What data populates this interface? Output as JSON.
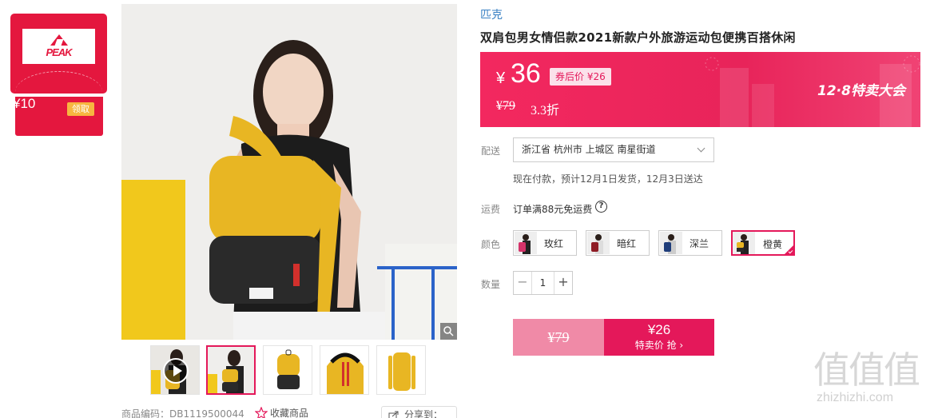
{
  "coupon": {
    "brand_logo": "PEAK",
    "amount": "¥10",
    "claim_label": "领取"
  },
  "product": {
    "brand": "匹克",
    "title": "双肩包男女情侣款2021新款户外旅游运动包便携百搭休闲",
    "sku_code": "商品编码：DB1119500044",
    "favorite_label": "收藏商品",
    "share_label": "分享到：",
    "thumbnail_count": 5,
    "active_thumbnail": 1
  },
  "price": {
    "currency": "¥",
    "current": "36",
    "after_coupon": "券后价 ¥26",
    "original": "¥79",
    "discount": "3.3折",
    "event": "12·8特卖大会"
  },
  "delivery": {
    "label": "配送",
    "address": "浙江省 杭州市 上城区 南星街道",
    "note": "现在付款，预计12月1日发货，12月3日送达"
  },
  "shipping": {
    "label": "运费",
    "text": "订单满88元免运费",
    "help": "?"
  },
  "color": {
    "label": "颜色",
    "options": [
      "玫红",
      "暗红",
      "深兰",
      "橙黄"
    ],
    "selected_index": 3
  },
  "quantity": {
    "label": "数量",
    "value": "1",
    "minus": "−",
    "plus": "+"
  },
  "buy": {
    "original_price": "¥79",
    "sale_price": "¥26",
    "label": "特卖价 抢 ›"
  },
  "watermark": {
    "chars": "值值值",
    "url": "zhizhizhi.com"
  },
  "colors": {
    "accent": "#e4185a",
    "coupon_red": "#e4173e",
    "link_blue": "#3b82c4",
    "product_yellow": "#e8b623"
  },
  "icons": {
    "zoom": "magnifier-icon",
    "play": "play-icon",
    "favorite": "star-icon",
    "share": "share-icon",
    "chevron": "chevron-down-icon",
    "check": "checkmark-icon"
  }
}
